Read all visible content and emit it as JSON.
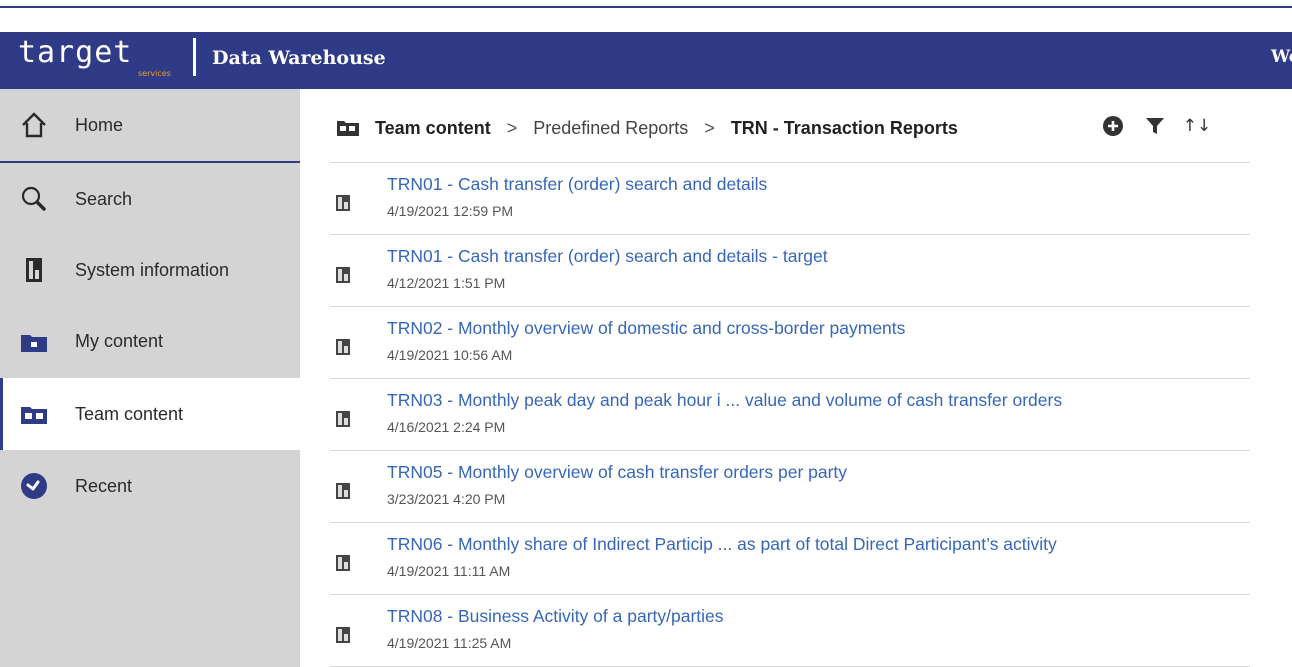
{
  "header": {
    "logo_text": "target",
    "logo_sub": "services",
    "app_title": "Data Warehouse",
    "welcome_text": "We"
  },
  "sidebar": {
    "items": [
      {
        "label": "Home",
        "icon": "home-icon"
      },
      {
        "label": "Search",
        "icon": "search-icon"
      },
      {
        "label": "System information",
        "icon": "report-icon"
      },
      {
        "label": "My content",
        "icon": "personal-folder-icon"
      },
      {
        "label": "Team content",
        "icon": "team-folder-icon",
        "active": true
      },
      {
        "label": "Recent",
        "icon": "recent-icon"
      }
    ]
  },
  "breadcrumb": {
    "items": [
      "Team content",
      "Predefined Reports",
      "TRN - Transaction Reports"
    ],
    "separator": ">"
  },
  "toolbar": {
    "icons": [
      "add-icon",
      "filter-icon",
      "sort-icon"
    ],
    "sort_glyph": "↑↓"
  },
  "reports": [
    {
      "title": "TRN01 - Cash transfer (order) search and details",
      "date": "4/19/2021 12:59 PM"
    },
    {
      "title": "TRN01 - Cash transfer (order) search and details - target",
      "date": "4/12/2021 1:51 PM"
    },
    {
      "title": "TRN02 - Monthly overview of domestic and cross-border payments",
      "date": "4/19/2021 10:56 AM"
    },
    {
      "title": "TRN03 - Monthly peak day and peak hour i ... value and volume of cash transfer orders",
      "date": "4/16/2021 2:24 PM"
    },
    {
      "title": "TRN05 - Monthly overview of cash transfer orders per party",
      "date": "3/23/2021 4:20 PM"
    },
    {
      "title": "TRN06 - Monthly share of Indirect Particip ... as part of total Direct Participant’s activity",
      "date": "4/19/2021 11:11 AM"
    },
    {
      "title": "TRN08 - Business Activity of a party/parties",
      "date": "4/19/2021 11:25 AM"
    }
  ],
  "colors": {
    "brand": "#2f3b86",
    "link": "#3766b8",
    "sidebar_bg": "#d4d4d4"
  }
}
